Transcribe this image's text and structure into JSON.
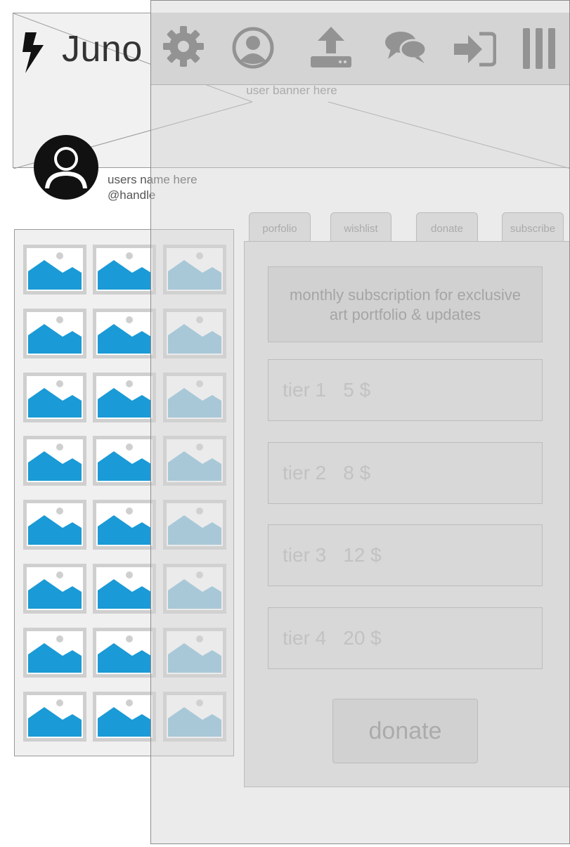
{
  "app": {
    "title": "Juno",
    "logo_icon": "lightning-bolt-icon"
  },
  "banner": {
    "label": "user banner here"
  },
  "nav": {
    "icons": [
      "gear-icon",
      "user-icon",
      "upload-icon",
      "chat-icon",
      "login-icon",
      "menu-icon"
    ]
  },
  "user": {
    "name": "users name here",
    "handle": "@handle"
  },
  "gallery": {
    "rows": 8,
    "columns": 3,
    "item_icon": "image-placeholder-icon"
  },
  "tabs": [
    {
      "label": "porfolio"
    },
    {
      "label": "wishlist"
    },
    {
      "label": "donate"
    },
    {
      "label": "subscribe"
    }
  ],
  "subscription": {
    "headline_line1": "monthly subscription for exclusive",
    "headline_line2": "art portfolio & updates",
    "tiers": [
      {
        "name": "tier 1",
        "price": "5 $"
      },
      {
        "name": "tier 2",
        "price": "8 $"
      },
      {
        "name": "tier 3",
        "price": "12 $"
      },
      {
        "name": "tier 4",
        "price": "20 $"
      }
    ]
  },
  "donate_button": {
    "label": "donate"
  },
  "colors": {
    "image_blue": "#1a9ad6",
    "image_blue_light": "#86bfdc",
    "nav_icon": "#606060"
  }
}
